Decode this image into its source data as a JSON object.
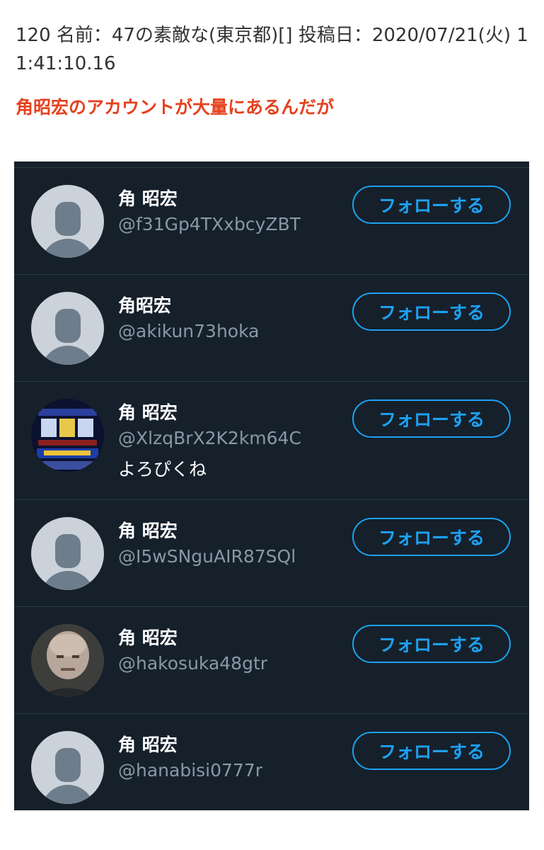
{
  "post": {
    "header": "120 名前：47の素敵な(東京都)[] 投稿日：2020/07/21(火) 11:41:10.16",
    "body": "角昭宏のアカウントが大量にあるんだが"
  },
  "accounts": [
    {
      "name": "角 昭宏",
      "handle": "@f31Gp4TXxbcyZBT",
      "follow_label": "フォローする"
    },
    {
      "name": "角昭宏",
      "handle": "@akikun73hoka",
      "follow_label": "フォローする"
    },
    {
      "name": "角 昭宏",
      "handle": "@XlzqBrX2K2km64C",
      "bio": "よろぴくね",
      "follow_label": "フォローする"
    },
    {
      "name": "角 昭宏",
      "handle": "@I5wSNguAIR87SQl",
      "follow_label": "フォローする"
    },
    {
      "name": "角 昭宏",
      "handle": "@hakosuka48gtr",
      "follow_label": "フォローする"
    },
    {
      "name": "角 昭宏",
      "handle": "@hanabisi0777r",
      "follow_label": "フォローする"
    }
  ],
  "colors": {
    "background": "#15202b",
    "accent": "#1da1f2",
    "handle": "#8899a6",
    "headline": "#e5421f"
  }
}
